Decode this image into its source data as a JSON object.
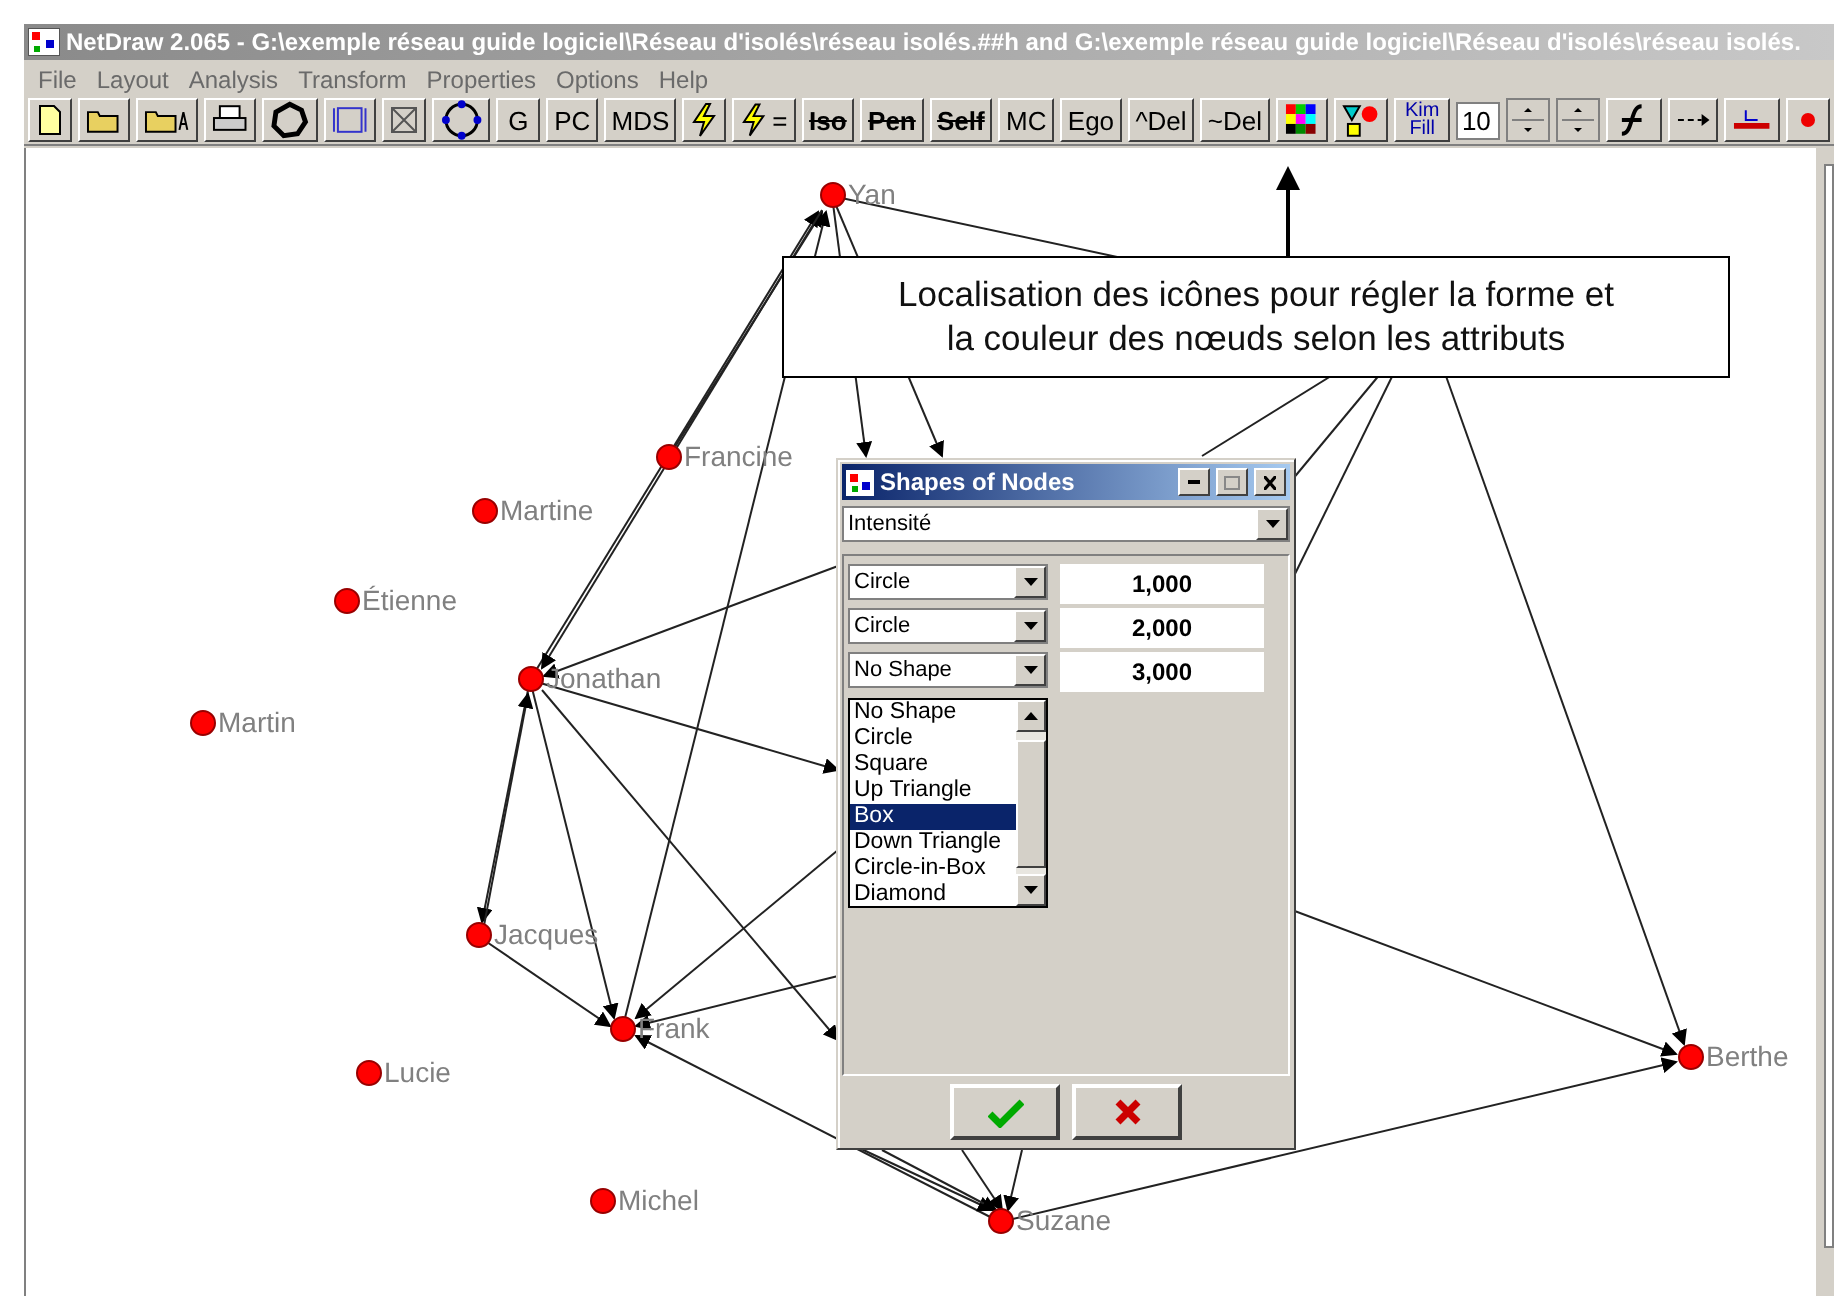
{
  "window": {
    "title": "NetDraw 2.065 - G:\\exemple réseau guide logiciel\\Réseau d'isolés\\réseau isolés.##h and G:\\exemple réseau guide logiciel\\Réseau d'isolés\\réseau isolés."
  },
  "menu": [
    "File",
    "Layout",
    "Analysis",
    "Transform",
    "Properties",
    "Options",
    "Help"
  ],
  "toolbar": [
    {
      "kind": "icon"
    },
    {
      "kind": "icon"
    },
    {
      "kind": "icon"
    },
    {
      "kind": "icon"
    },
    {
      "kind": "icon"
    },
    {
      "kind": "icon"
    },
    {
      "kind": "icon"
    },
    {
      "kind": "icon"
    },
    {
      "kind": "text",
      "label": "G",
      "struck": false
    },
    {
      "kind": "text",
      "label": "PC",
      "struck": false
    },
    {
      "kind": "text",
      "label": "MDS",
      "struck": false
    },
    {
      "kind": "icon"
    },
    {
      "kind": "icon",
      "label": "="
    },
    {
      "kind": "text",
      "label": "Iso",
      "struck": true
    },
    {
      "kind": "text",
      "label": "Pen",
      "struck": true
    },
    {
      "kind": "text",
      "label": "Self",
      "struck": true
    },
    {
      "kind": "text",
      "label": "MC",
      "struck": false
    },
    {
      "kind": "text",
      "label": "Ego",
      "struck": false
    },
    {
      "kind": "text",
      "label": "^Del",
      "struck": false
    },
    {
      "kind": "text",
      "label": "~Del",
      "struck": false
    },
    {
      "kind": "icon"
    },
    {
      "kind": "icon"
    },
    {
      "kind": "text",
      "label": "Kim Fill",
      "struck": false
    },
    {
      "kind": "field",
      "value": "10"
    },
    {
      "kind": "spinner"
    },
    {
      "kind": "spinner"
    },
    {
      "kind": "icon"
    },
    {
      "kind": "icon"
    },
    {
      "kind": "icon"
    },
    {
      "kind": "icon"
    }
  ],
  "nodes": [
    {
      "label": "Yan"
    },
    {
      "label": "Francine"
    },
    {
      "label": "Martine"
    },
    {
      "label": "Étienne"
    },
    {
      "label": "Jonathan"
    },
    {
      "label": "Martin"
    },
    {
      "label": "Jacques"
    },
    {
      "label": "Frank"
    },
    {
      "label": "Lucie"
    },
    {
      "label": "Michel"
    },
    {
      "label": "Suzane"
    },
    {
      "label": "Berthe"
    }
  ],
  "callout": {
    "text": "Localisation des icônes pour régler la forme et la couleur des nœuds selon les attributs"
  },
  "dialog": {
    "title": "Shapes of Nodes",
    "attribute": "Intensité",
    "rows": [
      {
        "shape": "Circle",
        "value": "1,000"
      },
      {
        "shape": "Circle",
        "value": "2,000"
      },
      {
        "shape": "No Shape",
        "value": "3,000"
      }
    ],
    "options": [
      {
        "label": "No Shape",
        "selected": false
      },
      {
        "label": "Circle",
        "selected": false
      },
      {
        "label": "Square",
        "selected": false
      },
      {
        "label": "Up Triangle",
        "selected": false
      },
      {
        "label": "Box",
        "selected": true
      },
      {
        "label": "Down Triangle",
        "selected": false
      },
      {
        "label": "Circle-in-Box",
        "selected": false
      },
      {
        "label": "Diamond",
        "selected": false
      }
    ]
  }
}
